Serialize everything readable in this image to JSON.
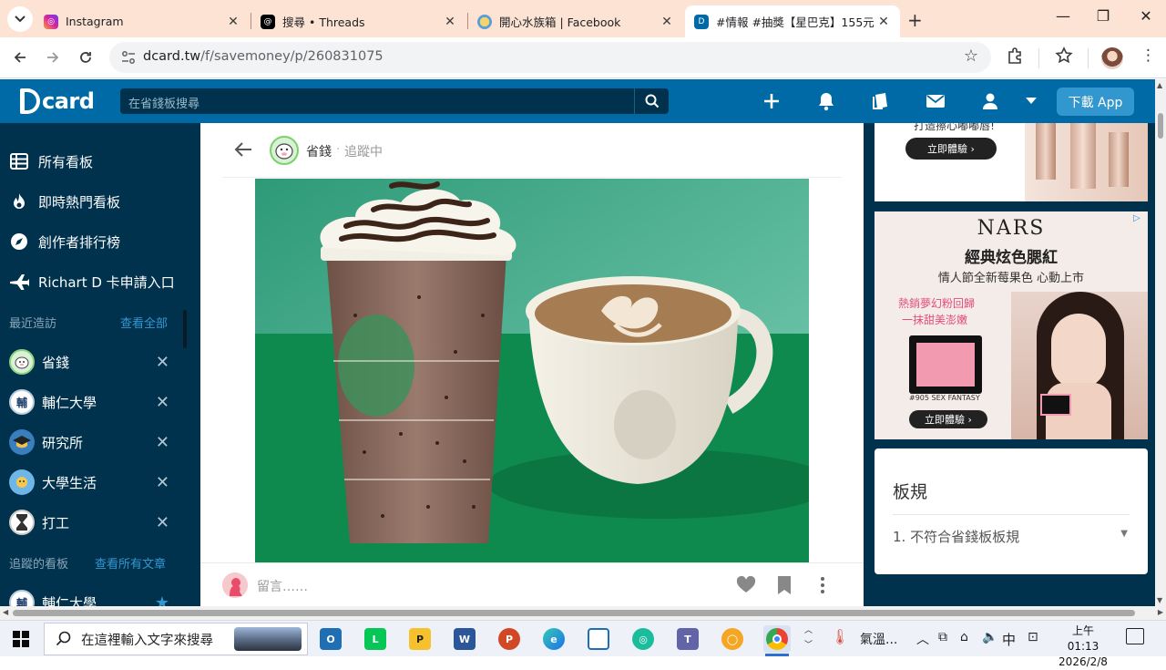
{
  "browser": {
    "tabs": [
      {
        "title": "Instagram",
        "color": "#d6249f"
      },
      {
        "title": "搜尋 • Threads",
        "color": "#000000"
      },
      {
        "title": "開心水族箱 | Facebook",
        "color": "#e8b23a"
      },
      {
        "title": "#情報 #抽獎【星巴克】155元",
        "color": "#006aa6"
      }
    ],
    "url_host": "dcard.tw",
    "url_path": "/f/savemoney/p/260831075"
  },
  "dcard": {
    "logo_text": "card",
    "search_placeholder": "在省錢板搜尋",
    "download_label": "下載 App"
  },
  "sidebar": {
    "nav": [
      {
        "label": "所有看板",
        "icon": "list-icon"
      },
      {
        "label": "即時熱門看板",
        "icon": "fire-icon"
      },
      {
        "label": "創作者排行榜",
        "icon": "rocket-icon"
      },
      {
        "label": "Richart D 卡申請入口",
        "icon": "airplane-icon"
      }
    ],
    "recent_title": "最近造訪",
    "recent_link": "查看全部",
    "recent_boards": [
      {
        "label": "省錢",
        "icon": "savemoney-avatar-icon",
        "bg": "#d9f2d6"
      },
      {
        "label": "輔仁大學",
        "icon": "fju-avatar-icon",
        "bg": "#ffffff"
      },
      {
        "label": "研究所",
        "icon": "graduate-avatar-icon",
        "bg": "#3a7fbd"
      },
      {
        "label": "大學生活",
        "icon": "campus-avatar-icon",
        "bg": "#6fb6e8"
      },
      {
        "label": "打工",
        "icon": "work-avatar-icon",
        "bg": "#ffffff"
      }
    ],
    "followed_title": "追蹤的看板",
    "followed_link": "查看所有文章",
    "followed_partial": "輔仁大學"
  },
  "post": {
    "forum_name": "省錢",
    "separator": "·",
    "follow_status": "追蹤中",
    "comment_placeholder": "留言……"
  },
  "ads": {
    "top_cta": "立即體驗",
    "top_text": "打造擦心嘟嘟唇!",
    "nars_brand": "NARS",
    "nars_title": "經典炫色腮紅",
    "nars_subtitle": "情人節全新莓果色 心動上市",
    "nars_tag1": "熱銷夢幻粉回歸",
    "nars_tag2": "一抹甜美澎嫩",
    "nars_shade": "#905 SEX FANTASY",
    "nars_cta": "立即體驗"
  },
  "rules": {
    "title": "板規",
    "item_num": "1.",
    "item_text": "不符合省錢板板規"
  },
  "taskbar": {
    "search_placeholder": "在這裡輸入文字來搜尋",
    "weather": "氣溫...",
    "ime": "中",
    "time": "上午 01:13",
    "date": "2026/2/8"
  }
}
